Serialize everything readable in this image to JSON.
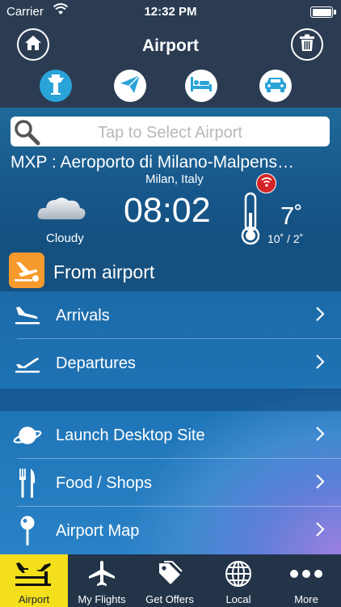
{
  "status_bar": {
    "carrier": "Carrier",
    "time": "12:32 PM"
  },
  "nav": {
    "title": "Airport",
    "left_icon": "home-icon",
    "right_icon": "trash-icon",
    "modes": [
      {
        "icon": "control-tower-icon",
        "active": true
      },
      {
        "icon": "paper-plane-icon",
        "active": false
      },
      {
        "icon": "hotel-bed-icon",
        "active": false
      },
      {
        "icon": "car-icon",
        "active": false
      }
    ]
  },
  "search": {
    "placeholder": "Tap to Select Airport"
  },
  "airport": {
    "name": "MXP : Aeroporto di Milano-Malpens…",
    "city": "Milan, Italy",
    "local_time": "08:02"
  },
  "weather": {
    "condition": "Cloudy",
    "temp_now": "7˚",
    "temp_range": "10˚ /   2˚"
  },
  "section": {
    "title": "From airport",
    "icon": "takeoff-icon",
    "icon_bg": "#f79a2d"
  },
  "menu": [
    {
      "label": "Arrivals",
      "icon": "arrivals-plane-icon"
    },
    {
      "label": "Departures",
      "icon": "departures-plane-icon"
    },
    {
      "label": "Launch Desktop Site",
      "icon": "planet-icon"
    },
    {
      "label": "Food / Shops",
      "icon": "fork-knife-icon"
    },
    {
      "label": "Airport Map",
      "icon": "map-pin-icon"
    }
  ],
  "tabs": [
    {
      "label": "Airport",
      "icon": "airport-icon",
      "active": true
    },
    {
      "label": "My Flights",
      "icon": "airplane-icon",
      "active": false
    },
    {
      "label": "Get Offers",
      "icon": "tags-icon",
      "active": false
    },
    {
      "label": "Local",
      "icon": "globe-icon",
      "active": false
    },
    {
      "label": "More",
      "icon": "more-dots-icon",
      "active": false
    }
  ],
  "colors": {
    "header_bg": "#2b3c52",
    "tab_active": "#f3df1b",
    "mode_active": "#2aa3d8",
    "alert_red": "#d42426"
  }
}
